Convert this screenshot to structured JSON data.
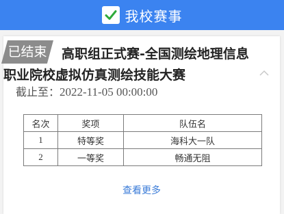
{
  "header": {
    "title": "我校赛事",
    "icon": "check-icon",
    "check_color": "#2eaa3a",
    "bg_color": "#3b83f0"
  },
  "event": {
    "badge": "已结束",
    "title": "高职组正式赛-全国测绘地理信息职业院校虚拟仿真测绘技能大赛",
    "deadline_label": "截止至：",
    "deadline_value": "2022-11-05 00:00:00",
    "toggle_icon": "chevron-up-icon"
  },
  "results": {
    "columns": [
      "名次",
      "奖项",
      "队伍名"
    ],
    "rows": [
      {
        "rank": "1",
        "award": "特等奖",
        "team": "海科大一队"
      },
      {
        "rank": "2",
        "award": "一等奖",
        "team": "畅通无阻"
      }
    ]
  },
  "more_link": "查看更多"
}
